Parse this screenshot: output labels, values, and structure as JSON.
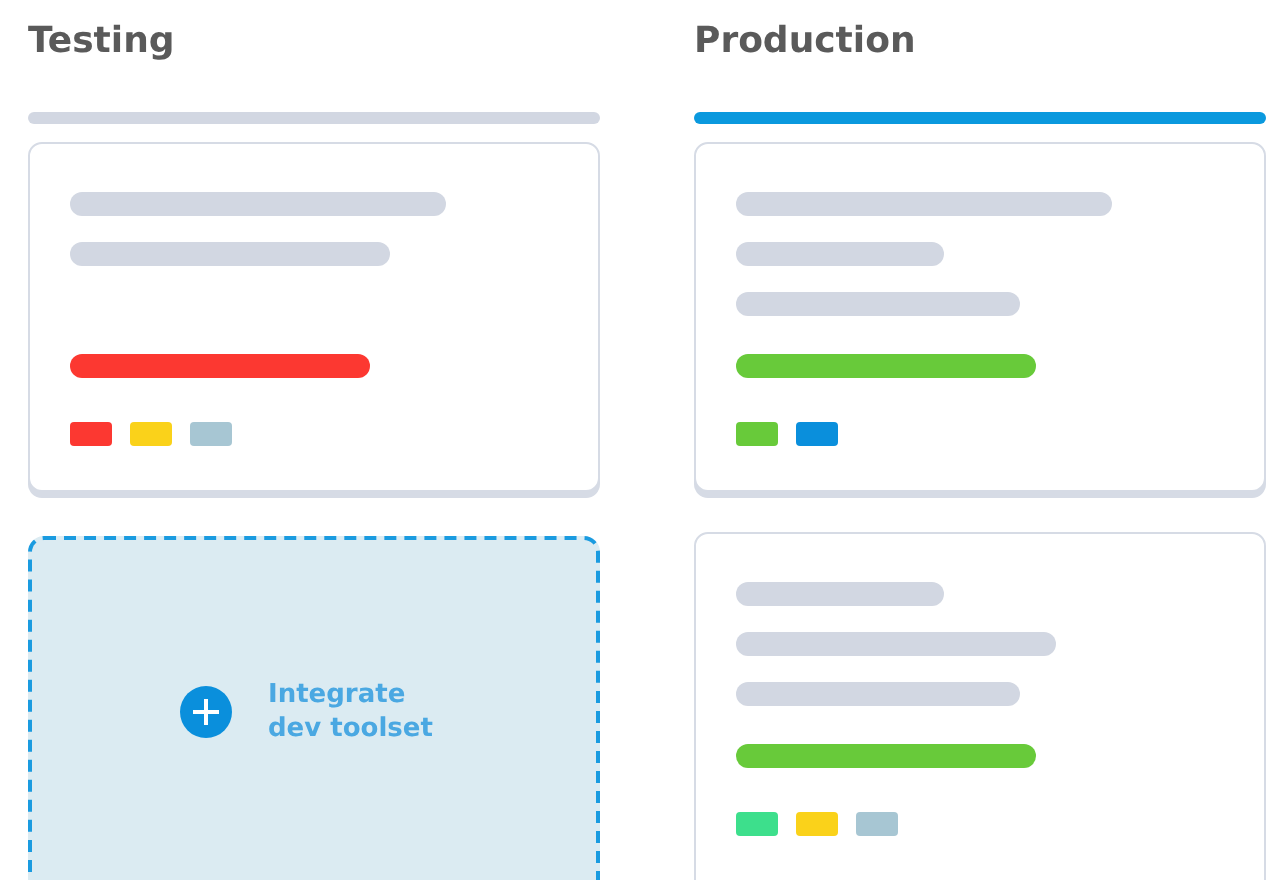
{
  "columns": [
    {
      "title": "Testing",
      "color": "#d2d7e2",
      "cards": [
        {
          "kind": "task",
          "lines": [
            {
              "kind": "long"
            },
            {
              "kind": "medium"
            }
          ],
          "bar": {
            "color": "#fc3831"
          },
          "tags": [
            {
              "color": "#fc3831"
            },
            {
              "color": "#fad21a"
            },
            {
              "color": "#a7c6d3"
            }
          ]
        },
        {
          "kind": "add",
          "label": "Integrate dev toolset"
        }
      ]
    },
    {
      "title": "Production",
      "color": "#0a99de",
      "cards": [
        {
          "kind": "task",
          "lines": [
            {
              "kind": "long"
            },
            {
              "kind": "tiny"
            },
            {
              "kind": "short"
            }
          ],
          "bar": {
            "color": "#68ca3a"
          },
          "tags": [
            {
              "color": "#68ca3a"
            },
            {
              "color": "#0a8fdc"
            }
          ]
        },
        {
          "kind": "task",
          "lines": [
            {
              "kind": "tiny"
            },
            {
              "kind": "medium"
            },
            {
              "kind": "short"
            }
          ],
          "bar": {
            "color": "#68ca3a"
          },
          "tags": [
            {
              "color": "#3ddf8c"
            },
            {
              "color": "#fad21a"
            },
            {
              "color": "#a7c6d3"
            }
          ]
        }
      ]
    }
  ]
}
